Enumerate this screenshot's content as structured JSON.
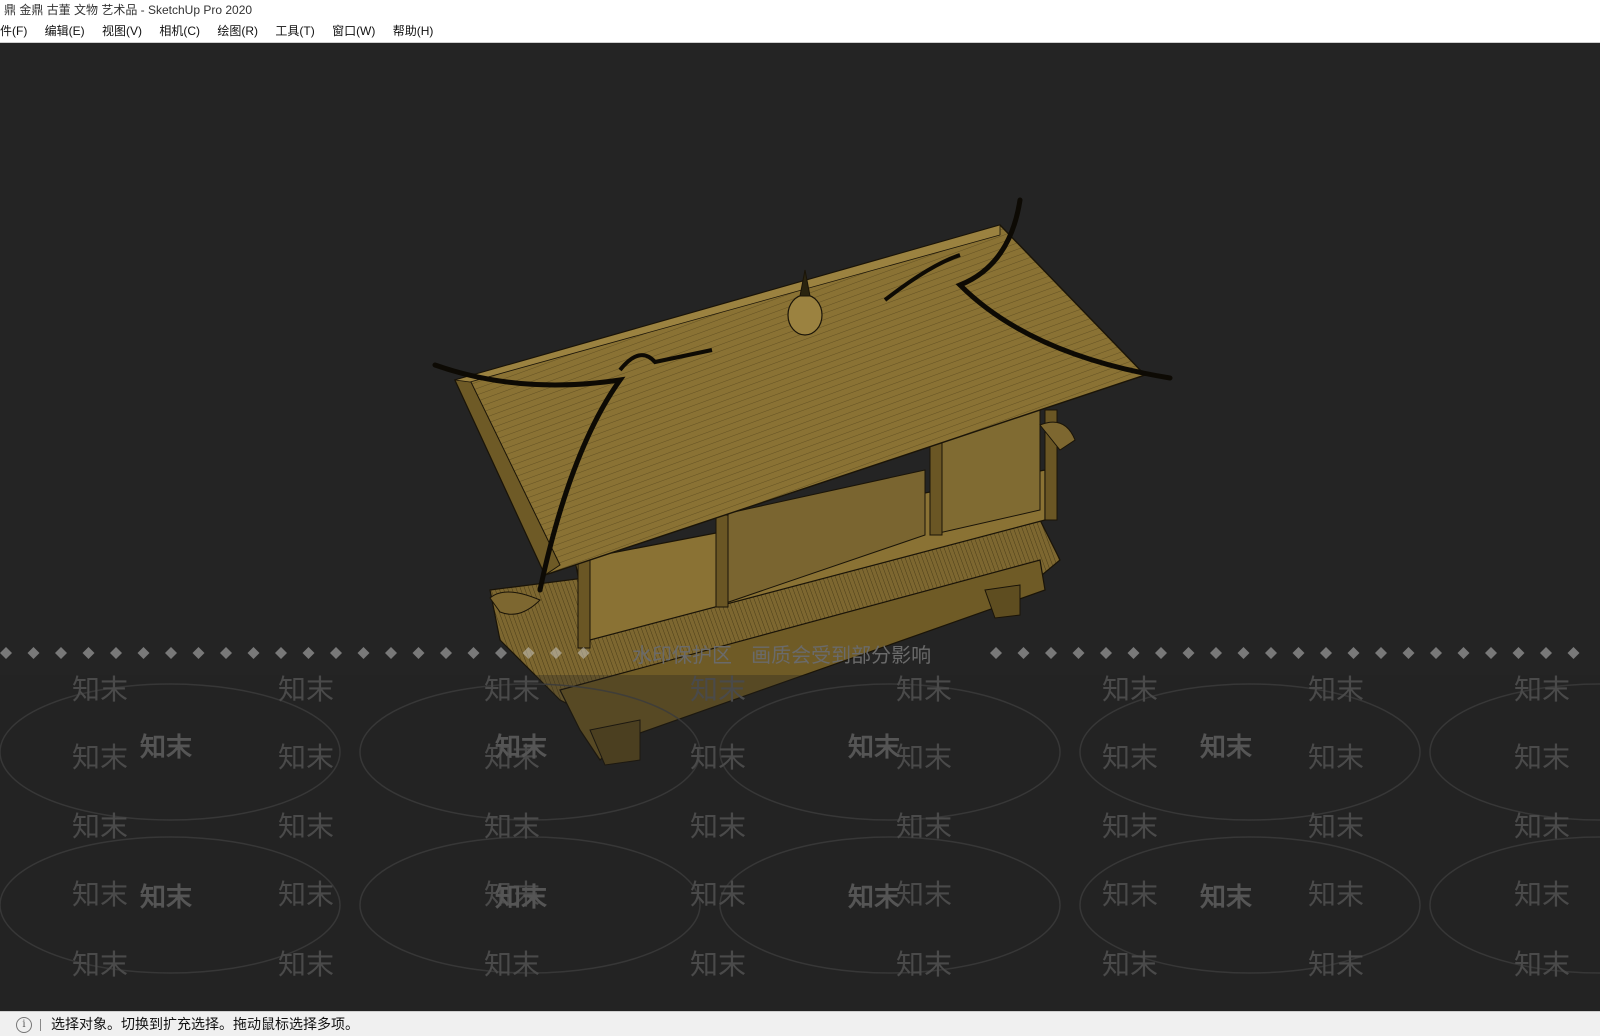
{
  "window": {
    "title": "鼎 金鼎 古董 文物 艺术品 - SketchUp Pro 2020"
  },
  "menu": [
    {
      "label": "件(F)"
    },
    {
      "label": "编辑(E)"
    },
    {
      "label": "视图(V)"
    },
    {
      "label": "相机(C)"
    },
    {
      "label": "绘图(R)"
    },
    {
      "label": "工具(T)"
    },
    {
      "label": "窗口(W)"
    },
    {
      "label": "帮助(H)"
    }
  ],
  "watermark": {
    "banner": "水印保护区   画质会受到部分影响",
    "brand": "知末"
  },
  "status": {
    "info_icon": "info-icon",
    "text": "选择对象。切换到扩充选择。拖动鼠标选择多项。"
  },
  "colors": {
    "viewport_bg": "#242424",
    "model_fill": "#8a7234",
    "model_edge": "#1a1408"
  }
}
